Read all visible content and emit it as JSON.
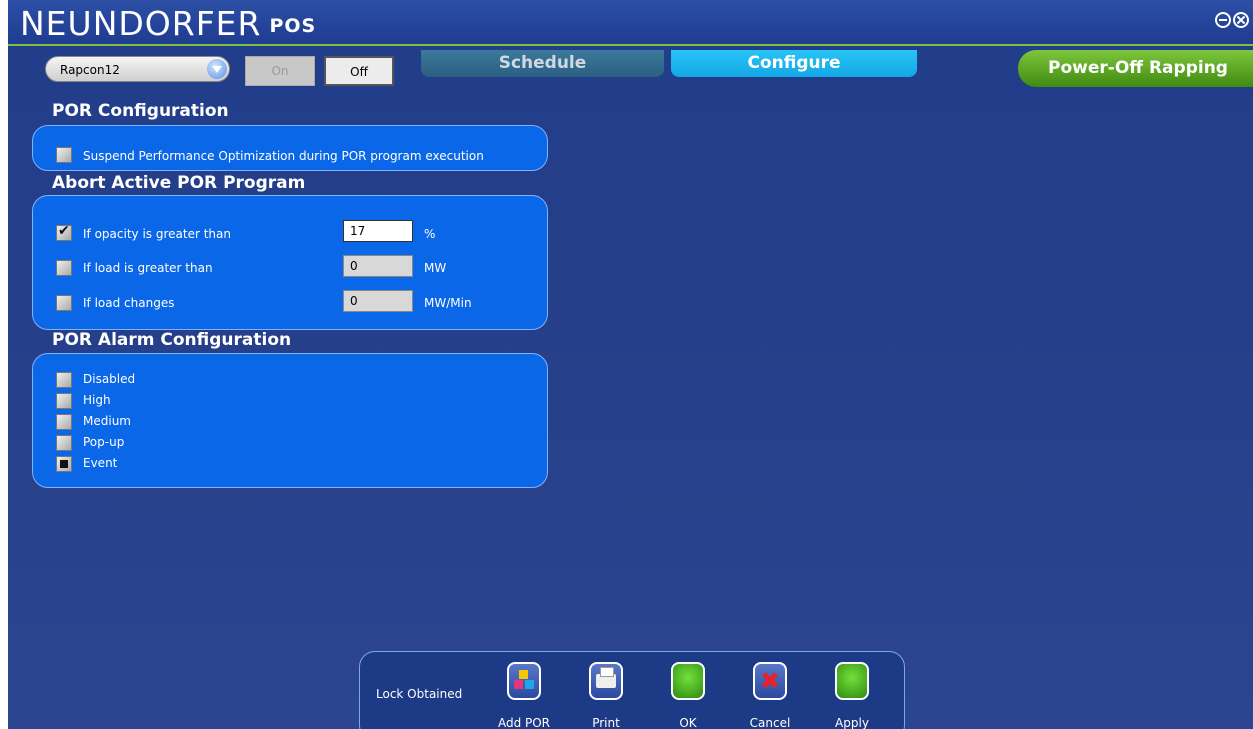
{
  "app": {
    "brand": "NEUNDORFER",
    "brand_suffix": "POS"
  },
  "toolbar": {
    "device_value": "Rapcon12",
    "on_label": "On",
    "off_label": "Off"
  },
  "tabs": {
    "schedule": "Schedule",
    "configure": "Configure",
    "power_off_rapping": "Power-Off Rapping"
  },
  "por_config": {
    "title": "POR Configuration",
    "suspend_label": "Suspend Performance Optimization during POR program execution",
    "suspend_checked": false
  },
  "abort": {
    "title": "Abort Active POR Program",
    "opacity": {
      "label": "If opacity is greater than",
      "value": "17",
      "unit": "%",
      "checked": true
    },
    "load": {
      "label": "If load is greater than",
      "value": "0",
      "unit": "MW",
      "checked": false
    },
    "load_change": {
      "label": "If load changes",
      "value": "0",
      "unit": "MW/Min",
      "checked": false
    }
  },
  "alarm": {
    "title": "POR Alarm Configuration",
    "options": [
      "Disabled",
      "High",
      "Medium",
      "Pop-up",
      "Event"
    ],
    "selected": "Event"
  },
  "bottom": {
    "lock_status": "Lock Obtained",
    "add_por": "Add POR",
    "print": "Print",
    "ok": "OK",
    "cancel": "Cancel",
    "apply": "Apply"
  }
}
